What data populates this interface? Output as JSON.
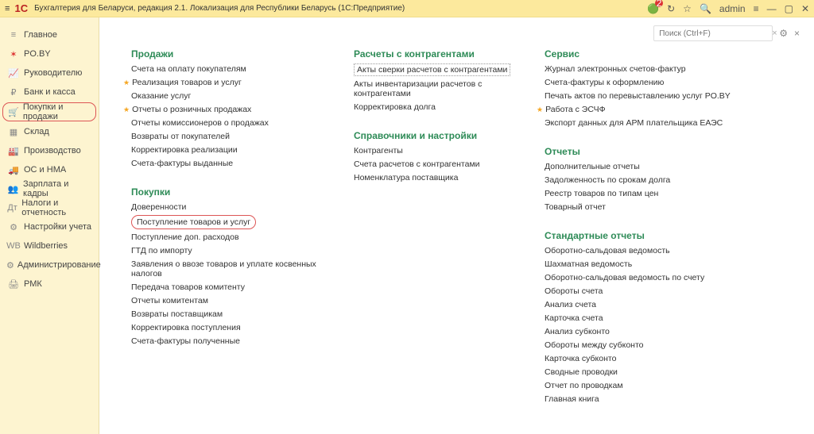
{
  "titlebar": {
    "logo": "1С",
    "title": "Бухгалтерия для Беларуси, редакция 2.1. Локализация для Республики Беларусь  (1С:Предприятие)",
    "user": "admin",
    "notif_count": "2"
  },
  "search": {
    "placeholder": "Поиск (Ctrl+F)"
  },
  "sidebar": {
    "items": [
      {
        "icon": "≡",
        "label": "Главное"
      },
      {
        "icon": "✶",
        "label": "PO.BY"
      },
      {
        "icon": "📈",
        "label": "Руководителю"
      },
      {
        "icon": "₽",
        "label": "Банк и касса"
      },
      {
        "icon": "🛒",
        "label": "Покупки и продажи"
      },
      {
        "icon": "▦",
        "label": "Склад"
      },
      {
        "icon": "🏭",
        "label": "Производство"
      },
      {
        "icon": "🚚",
        "label": "ОС и НМА"
      },
      {
        "icon": "👥",
        "label": "Зарплата и кадры"
      },
      {
        "icon": "Дт",
        "label": "Налоги и отчетность"
      },
      {
        "icon": "⚙",
        "label": "Настройки учета"
      },
      {
        "icon": "WB",
        "label": "Wildberries"
      },
      {
        "icon": "⚙",
        "label": "Администрирование"
      },
      {
        "icon": "🖨",
        "label": "РМК"
      }
    ]
  },
  "content": {
    "col1": {
      "s1": {
        "title": "Продажи",
        "items": [
          {
            "label": "Счета на оплату покупателям"
          },
          {
            "label": "Реализация товаров и услуг",
            "star": true
          },
          {
            "label": "Оказание услуг"
          },
          {
            "label": "Отчеты о розничных продажах",
            "star": true
          },
          {
            "label": "Отчеты комиссионеров о продажах"
          },
          {
            "label": "Возвраты от покупателей"
          },
          {
            "label": "Корректировка реализации"
          },
          {
            "label": "Счета-фактуры выданные"
          }
        ]
      },
      "s2": {
        "title": "Покупки",
        "items": [
          {
            "label": "Доверенности"
          },
          {
            "label": "Поступление товаров и услуг",
            "redbox": true
          },
          {
            "label": "Поступление доп. расходов"
          },
          {
            "label": "ГТД по импорту"
          },
          {
            "label": "Заявления о ввозе товаров и уплате косвенных налогов"
          },
          {
            "label": "Передача товаров комитенту"
          },
          {
            "label": "Отчеты комитентам"
          },
          {
            "label": "Возвраты поставщикам"
          },
          {
            "label": "Корректировка поступления"
          },
          {
            "label": "Счета-фактуры полученные"
          }
        ]
      }
    },
    "col2": {
      "s1": {
        "title": "Расчеты с контрагентами",
        "items": [
          {
            "label": "Акты сверки расчетов с контрагентами",
            "boxed": true
          },
          {
            "label": "Акты инвентаризации расчетов с контрагентами"
          },
          {
            "label": "Корректировка долга"
          }
        ]
      },
      "s2": {
        "title": "Справочники и настройки",
        "items": [
          {
            "label": "Контрагенты"
          },
          {
            "label": "Счета расчетов с контрагентами"
          },
          {
            "label": "Номенклатура поставщика"
          }
        ]
      }
    },
    "col3": {
      "s1": {
        "title": "Сервис",
        "items": [
          {
            "label": "Журнал электронных счетов-фактур"
          },
          {
            "label": "Счета-фактуры к оформлению"
          },
          {
            "label": "Печать актов по перевыставлению услуг PO.BY"
          },
          {
            "label": "Работа с ЭСЧФ",
            "star": true
          },
          {
            "label": "Экспорт данных для АРМ плательщика ЕАЭС"
          }
        ]
      },
      "s2": {
        "title": "Отчеты",
        "items": [
          {
            "label": "Дополнительные отчеты"
          },
          {
            "label": "Задолженность по срокам долга"
          },
          {
            "label": "Реестр товаров по типам цен"
          },
          {
            "label": "Товарный отчет"
          }
        ]
      },
      "s3": {
        "title": "Стандартные отчеты",
        "items": [
          {
            "label": "Оборотно-сальдовая ведомость"
          },
          {
            "label": "Шахматная ведомость"
          },
          {
            "label": "Оборотно-сальдовая ведомость по счету"
          },
          {
            "label": "Обороты счета"
          },
          {
            "label": "Анализ счета"
          },
          {
            "label": "Карточка счета"
          },
          {
            "label": "Анализ субконто"
          },
          {
            "label": "Обороты между субконто"
          },
          {
            "label": "Карточка субконто"
          },
          {
            "label": "Сводные проводки"
          },
          {
            "label": "Отчет по проводкам"
          },
          {
            "label": "Главная книга"
          }
        ]
      }
    }
  }
}
